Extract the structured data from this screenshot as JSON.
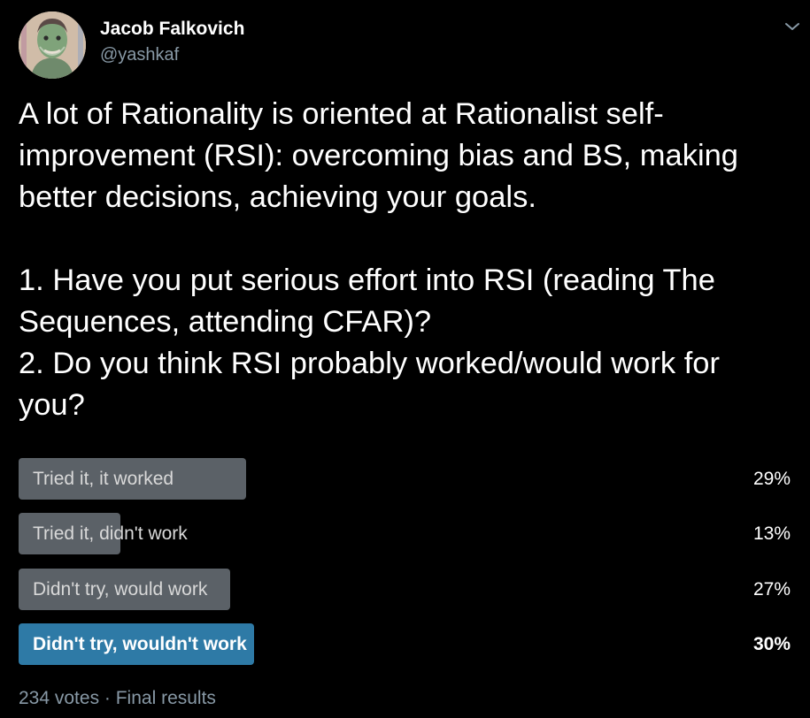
{
  "author": {
    "display_name": "Jacob Falkovich",
    "handle": "@yashkaf",
    "avatar_icon": "avatar-portrait-icon"
  },
  "menu": {
    "icon": "chevron-down-icon"
  },
  "tweet": {
    "lines": [
      "A lot of Rationality is oriented at Rationalist self-",
      "improvement (RSI): overcoming bias and BS, making",
      "better decisions, achieving your goals.",
      "",
      "1. Have you put serious effort into RSI (reading The",
      "Sequences, attending CFAR)?",
      "2. Do you think RSI probably worked/would work for",
      "you?"
    ]
  },
  "poll": {
    "options": [
      {
        "label": "Tried it, it worked",
        "percent_text": "29%",
        "percent": 29,
        "winner": false
      },
      {
        "label": "Tried it, didn't work",
        "percent_text": "13%",
        "percent": 13,
        "winner": false
      },
      {
        "label": "Didn't try, would work",
        "percent_text": "27%",
        "percent": 27,
        "winner": false
      },
      {
        "label": "Didn't try, wouldn't work",
        "percent_text": "30%",
        "percent": 30,
        "winner": true
      }
    ],
    "footer": "234 votes · Final results"
  },
  "colors": {
    "background": "#000000",
    "bar": "#5b6167",
    "winner_bar": "#2e7aa6",
    "secondary_text": "#8899a6"
  }
}
